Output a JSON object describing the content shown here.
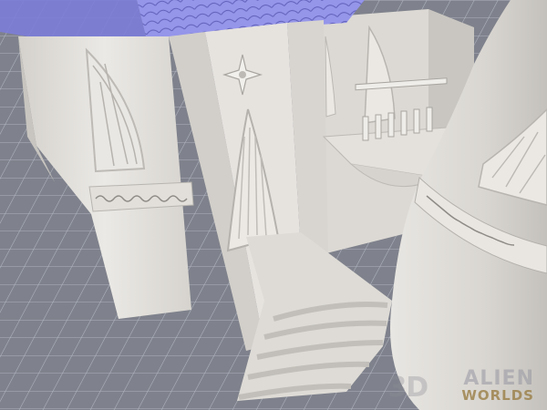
{
  "scene": {
    "subject": "castle-3d-model-render",
    "colors": {
      "floor": "#7f828c",
      "grid": "#a9adb8",
      "wall": "#e4e1dc",
      "wall_shade": "#cfcbc5",
      "roof": "#8f8fe6",
      "roof_dark": "#6e6ec8"
    }
  },
  "watermark": {
    "mark": "3D",
    "line1": "ALIEN",
    "line2": "WORLDS"
  }
}
